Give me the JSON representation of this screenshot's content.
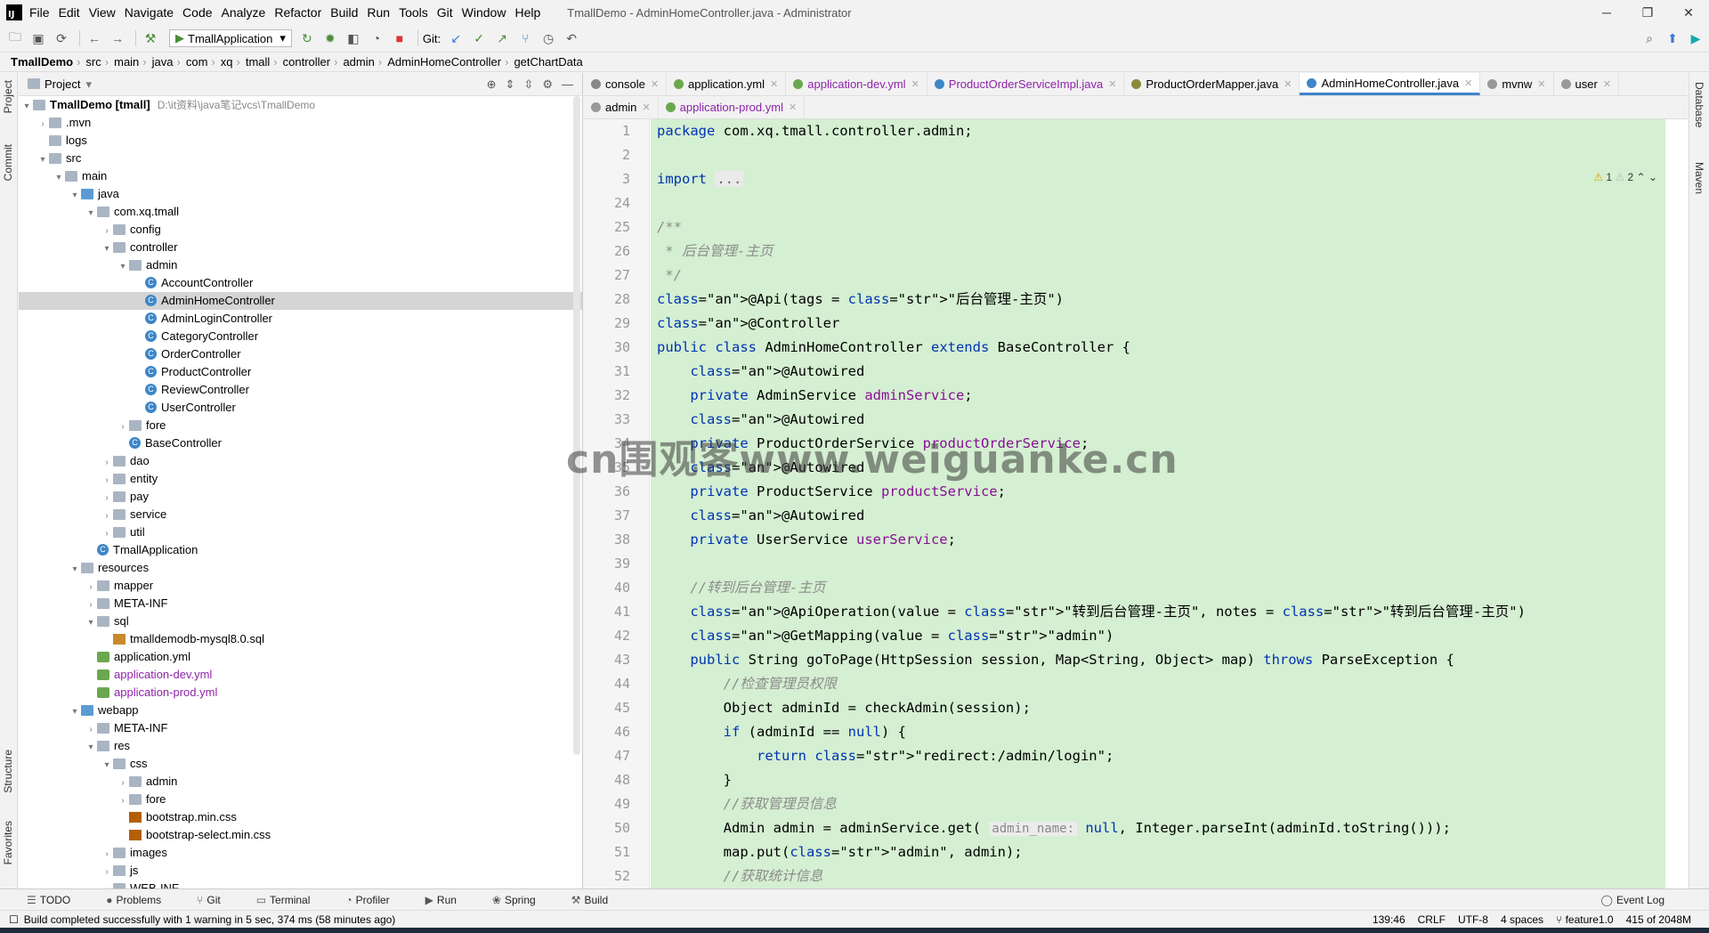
{
  "window": {
    "title": "TmallDemo - AdminHomeController.java - Administrator",
    "controls": [
      "─",
      "❐",
      "✕"
    ]
  },
  "menu": [
    "File",
    "Edit",
    "View",
    "Navigate",
    "Code",
    "Analyze",
    "Refactor",
    "Build",
    "Run",
    "Tools",
    "Git",
    "Window",
    "Help"
  ],
  "toolbar": {
    "run_config": "TmallApplication",
    "git_label": "Git:"
  },
  "breadcrumb": [
    "TmallDemo",
    "src",
    "main",
    "java",
    "com",
    "xq",
    "tmall",
    "controller",
    "admin",
    "AdminHomeController",
    "getChartData"
  ],
  "left_strip": {
    "project": "Project",
    "commit": "Commit",
    "structure": "Structure",
    "favorites": "Favorites"
  },
  "project": {
    "header": "Project",
    "root": {
      "name": "TmallDemo [tmall]",
      "path": "D:\\it资料\\java笔记vcs\\TmallDemo"
    },
    "items": [
      {
        "label": ".mvn"
      },
      {
        "label": "logs"
      },
      {
        "label": "src"
      },
      {
        "label": "main"
      },
      {
        "label": "java"
      },
      {
        "label": "com.xq.tmall"
      },
      {
        "label": "config"
      },
      {
        "label": "controller"
      },
      {
        "label": "admin"
      },
      {
        "label": "AccountController"
      },
      {
        "label": "AdminHomeController"
      },
      {
        "label": "AdminLoginController"
      },
      {
        "label": "CategoryController"
      },
      {
        "label": "OrderController"
      },
      {
        "label": "ProductController"
      },
      {
        "label": "ReviewController"
      },
      {
        "label": "UserController"
      },
      {
        "label": "fore"
      },
      {
        "label": "BaseController"
      },
      {
        "label": "dao"
      },
      {
        "label": "entity"
      },
      {
        "label": "pay"
      },
      {
        "label": "service"
      },
      {
        "label": "util"
      },
      {
        "label": "TmallApplication"
      },
      {
        "label": "resources"
      },
      {
        "label": "mapper"
      },
      {
        "label": "META-INF"
      },
      {
        "label": "sql"
      },
      {
        "label": "tmalldemodb-mysql8.0.sql"
      },
      {
        "label": "application.yml"
      },
      {
        "label": "application-dev.yml"
      },
      {
        "label": "application-prod.yml"
      },
      {
        "label": "webapp"
      },
      {
        "label": "META-INF"
      },
      {
        "label": "res"
      },
      {
        "label": "css"
      },
      {
        "label": "admin"
      },
      {
        "label": "fore"
      },
      {
        "label": "bootstrap.min.css"
      },
      {
        "label": "bootstrap-select.min.css"
      },
      {
        "label": "images"
      },
      {
        "label": "js"
      },
      {
        "label": "WEB-INF"
      }
    ]
  },
  "tabs_row1": [
    "console",
    "application.yml",
    "application-dev.yml",
    "ProductOrderServiceImpl.java",
    "ProductOrderMapper.java",
    "AdminHomeController.java",
    "mvnw",
    "user"
  ],
  "tabs_row2": [
    "admin",
    "application-prod.yml"
  ],
  "inspections": {
    "warnings": "1",
    "weak": "2"
  },
  "code_lines": [
    {
      "n": "1",
      "t": "package com.xq.tmall.controller.admin;"
    },
    {
      "n": "2",
      "t": ""
    },
    {
      "n": "3",
      "t": "import ..."
    },
    {
      "n": "24",
      "t": ""
    },
    {
      "n": "25",
      "t": "/**"
    },
    {
      "n": "26",
      "t": " * 后台管理-主页"
    },
    {
      "n": "27",
      "t": " */"
    },
    {
      "n": "28",
      "t": "@Api(tags = \"后台管理-主页\")"
    },
    {
      "n": "29",
      "t": "@Controller"
    },
    {
      "n": "30",
      "t": "public class AdminHomeController extends BaseController {"
    },
    {
      "n": "31",
      "t": "    @Autowired"
    },
    {
      "n": "32",
      "t": "    private AdminService adminService;"
    },
    {
      "n": "33",
      "t": "    @Autowired"
    },
    {
      "n": "34",
      "t": "    private ProductOrderService productOrderService;"
    },
    {
      "n": "35",
      "t": "    @Autowired"
    },
    {
      "n": "36",
      "t": "    private ProductService productService;"
    },
    {
      "n": "37",
      "t": "    @Autowired"
    },
    {
      "n": "38",
      "t": "    private UserService userService;"
    },
    {
      "n": "39",
      "t": ""
    },
    {
      "n": "40",
      "t": "    //转到后台管理-主页"
    },
    {
      "n": "41",
      "t": "    @ApiOperation(value = \"转到后台管理-主页\", notes = \"转到后台管理-主页\")"
    },
    {
      "n": "42",
      "t": "    @GetMapping(value = \"admin\")"
    },
    {
      "n": "43",
      "t": "    public String goToPage(HttpSession session, Map<String, Object> map) throws ParseException {"
    },
    {
      "n": "44",
      "t": "        //检查管理员权限"
    },
    {
      "n": "45",
      "t": "        Object adminId = checkAdmin(session);"
    },
    {
      "n": "46",
      "t": "        if (adminId == null) {"
    },
    {
      "n": "47",
      "t": "            return \"redirect:/admin/login\";"
    },
    {
      "n": "48",
      "t": "        }"
    },
    {
      "n": "49",
      "t": "        //获取管理员信息"
    },
    {
      "n": "50",
      "t": "        Admin admin = adminService.get( admin_name: null, Integer.parseInt(adminId.toString()));"
    },
    {
      "n": "51",
      "t": "        map.put(\"admin\", admin);"
    },
    {
      "n": "52",
      "t": "        //获取统计信息"
    }
  ],
  "right_strip": {
    "database": "Database",
    "maven": "Maven"
  },
  "bottom_tools": [
    "TODO",
    "Problems",
    "Git",
    "Terminal",
    "Profiler",
    "Run",
    "Spring",
    "Build",
    "Event Log"
  ],
  "status": {
    "message": "Build completed successfully with 1 warning in 5 sec, 374 ms (58 minutes ago)",
    "position": "139:46",
    "line_sep": "CRLF",
    "encoding": "UTF-8",
    "indent": "4 spaces",
    "branch": "feature1.0",
    "memory": "415 of 2048M"
  },
  "watermark": "cn围观客www.weiguanke.cn"
}
